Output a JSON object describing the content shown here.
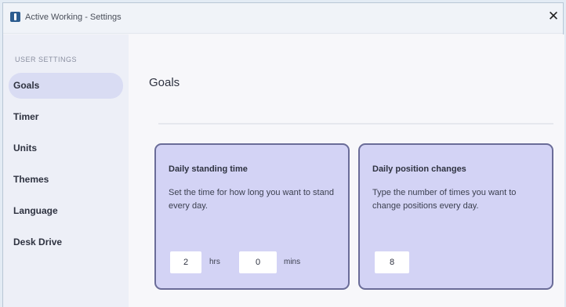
{
  "window": {
    "title": "Active Working - Settings"
  },
  "sidebar": {
    "heading": "USER SETTINGS",
    "items": [
      {
        "label": "Goals",
        "active": true
      },
      {
        "label": "Timer"
      },
      {
        "label": "Units"
      },
      {
        "label": "Themes"
      },
      {
        "label": "Language"
      },
      {
        "label": "Desk Drive"
      }
    ]
  },
  "main": {
    "title": "Goals",
    "cards": [
      {
        "title": "Daily standing time",
        "description": "Set the time for how long you want to stand every day.",
        "hours_value": "2",
        "hours_unit": "hrs",
        "minutes_value": "0",
        "minutes_unit": "mins"
      },
      {
        "title": "Daily position changes",
        "description": "Type the number of times you want to change positions every day.",
        "count_value": "8"
      }
    ]
  },
  "colors": {
    "card_background": "#d3d3f5",
    "card_border": "#6a6c98",
    "active_nav": "#d9dcf3"
  },
  "icons": {
    "app": "app-icon",
    "close": "close-icon"
  }
}
